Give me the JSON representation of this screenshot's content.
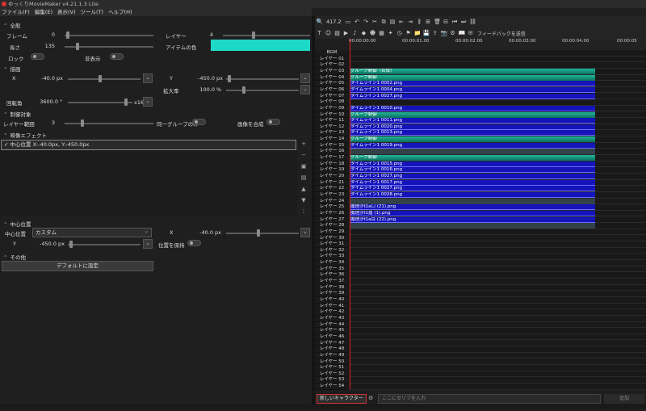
{
  "title": "ゆっくりMovieMaker v4.21.1.3 Lite",
  "menu": [
    "ファイル(F)",
    "編集(E)",
    "表示(V)",
    "ツール(T)",
    "ヘルプ(H)"
  ],
  "props": {
    "section_all": "全般",
    "frame_label": "フレーム",
    "frame_value": "0",
    "layer_label": "レイヤー",
    "layer_value": "4",
    "length_label": "長さ",
    "length_value": "135",
    "item_color_label": "アイテムの色",
    "item_color": "#1ed9c8",
    "lock_label": "ロック",
    "hidden_label": "非表示",
    "section_draw": "描画",
    "x_label": "X",
    "x_value": "-40.0",
    "y_label": "Y",
    "y_value": "-450.0",
    "unit_px": "px",
    "zoom_label": "拡大率",
    "zoom_value": "100.0",
    "unit_percent": "%",
    "rotation_label": "回転角",
    "rotation_value": "3600.0",
    "unit_deg": "°",
    "x16": "x16",
    "section_control": "制御対象",
    "layer_range_label": "レイヤー範囲",
    "layer_range_value": "3",
    "same_group_label": "同一グループのみ",
    "image_combine_label": "画像を合成",
    "section_effect": "映像エフェクト",
    "effect_item": "中心位置 X:-40.0px, Y:-450.0px",
    "section_center": "中心位置",
    "center_label": "中心位置",
    "center_mode": "カスタム",
    "cx_label": "X",
    "cx_value": "-40.0",
    "cy_label": "Y",
    "cy_value": "-450.0",
    "keep_pos_label": "位置を保持",
    "section_other": "その他",
    "default_button": "デフォルトに設定"
  },
  "toolbar": {
    "zoom_level": "417.2",
    "feedback": "フィードバックを送信"
  },
  "ruler_ticks": [
    "00:00:00.00",
    "00:00:01.00",
    "00:00:02.00",
    "00:00:03.00",
    "00:00:04.00",
    "00:00:05"
  ],
  "layers": [
    "BGM",
    "レイヤー 01",
    "レイヤー 02",
    "レイヤー 03",
    "レイヤー 04",
    "レイヤー 05",
    "レイヤー 06",
    "レイヤー 07",
    "レイヤー 08",
    "レイヤー 09",
    "レイヤー 10",
    "レイヤー 11",
    "レイヤー 12",
    "レイヤー 13",
    "レイヤー 14",
    "レイヤー 15",
    "レイヤー 16",
    "レイヤー 17",
    "レイヤー 18",
    "レイヤー 19",
    "レイヤー 20",
    "レイヤー 21",
    "レイヤー 22",
    "レイヤー 23",
    "レイヤー 24",
    "レイヤー 25",
    "レイヤー 26",
    "レイヤー 27",
    "レイヤー 28",
    "レイヤー 29",
    "レイヤー 30",
    "レイヤー 31",
    "レイヤー 32",
    "レイヤー 33",
    "レイヤー 34",
    "レイヤー 35",
    "レイヤー 36",
    "レイヤー 37",
    "レイヤー 38",
    "レイヤー 39",
    "レイヤー 40",
    "レイヤー 41",
    "レイヤー 42",
    "レイヤー 43",
    "レイヤー 44",
    "レイヤー 45",
    "レイヤー 46",
    "レイヤー 47",
    "レイヤー 48",
    "レイヤー 49",
    "レイヤー 50",
    "レイヤー 51",
    "レイヤー 52",
    "レイヤー 53",
    "レイヤー 54"
  ],
  "clips": [
    {
      "row": 3,
      "label": "グループ制御（合成）",
      "kind": "teal"
    },
    {
      "row": 4,
      "label": "グループ制御",
      "kind": "teal"
    },
    {
      "row": 5,
      "label": "タイムライン1 0002.png",
      "kind": "blue"
    },
    {
      "row": 6,
      "label": "タイムライン1 0004.png",
      "kind": "blue"
    },
    {
      "row": 7,
      "label": "タイムライン1 0027.png",
      "kind": "blue"
    },
    {
      "row": 9,
      "label": "タイムライン1 0010.png",
      "kind": "blue"
    },
    {
      "row": 10,
      "label": "グループ制御",
      "kind": "teal"
    },
    {
      "row": 11,
      "label": "タイムライン1 0011.png",
      "kind": "blue"
    },
    {
      "row": 12,
      "label": "タイムライン1 0020.png",
      "kind": "blue"
    },
    {
      "row": 13,
      "label": "タイムライン1 0013.png",
      "kind": "blue"
    },
    {
      "row": 14,
      "label": "グループ制御",
      "kind": "teal"
    },
    {
      "row": 15,
      "label": "タイムライン1 0019.png",
      "kind": "blue"
    },
    {
      "row": 16,
      "label": "",
      "kind": "gray"
    },
    {
      "row": 17,
      "label": "グループ制御",
      "kind": "teal"
    },
    {
      "row": 18,
      "label": "タイムライン1 0015.png",
      "kind": "blue"
    },
    {
      "row": 19,
      "label": "タイムライン1 0016.png",
      "kind": "blue"
    },
    {
      "row": 20,
      "label": "タイムライン1 0027.png",
      "kind": "blue"
    },
    {
      "row": 21,
      "label": "タイムライン1 0017.png",
      "kind": "blue"
    },
    {
      "row": 22,
      "label": "タイムライン1 0027.png",
      "kind": "blue"
    },
    {
      "row": 23,
      "label": "タイムライン1 0028.png",
      "kind": "blue"
    },
    {
      "row": 24,
      "label": "",
      "kind": "gray"
    },
    {
      "row": 25,
      "label": "魔理沙t1a口 (21).png",
      "kind": "blue"
    },
    {
      "row": 26,
      "label": "魔理沙t1眉 (1).png",
      "kind": "blue"
    },
    {
      "row": 27,
      "label": "魔理沙t1a目 (22).png",
      "kind": "blue"
    },
    {
      "row": 28,
      "label": "",
      "kind": "gray"
    }
  ],
  "bottom": {
    "character": "新しいキャラクター",
    "dialog_placeholder": "ここにセリフを入力",
    "add_label": "追加"
  }
}
